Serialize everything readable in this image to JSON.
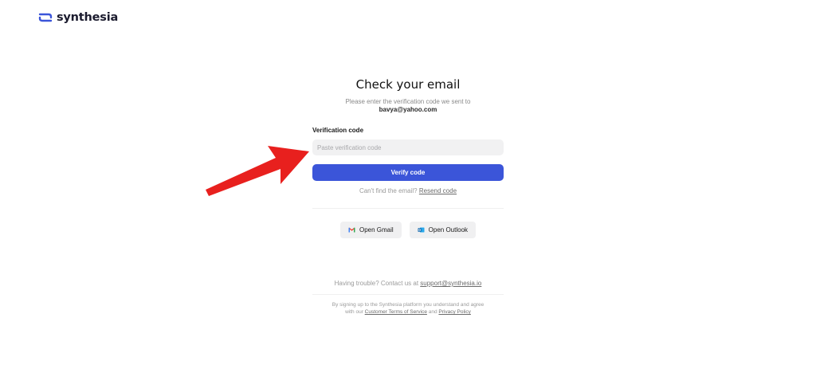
{
  "brand": {
    "name": "synthesia",
    "accent": "#3b55d9"
  },
  "page": {
    "title": "Check your email",
    "subtitle": "Please enter the verification code we sent to",
    "email": "bavya@yahoo.com"
  },
  "form": {
    "code_label": "Verification code",
    "code_placeholder": "Paste verification code",
    "code_value": "",
    "verify_label": "Verify code"
  },
  "resend": {
    "prompt": "Can't find the email?",
    "link": "Resend code"
  },
  "mail_buttons": [
    {
      "label": "Open Gmail",
      "icon": "gmail-icon"
    },
    {
      "label": "Open Outlook",
      "icon": "outlook-icon"
    }
  ],
  "support": {
    "prompt": "Having trouble? Contact us at",
    "email": "support@synthesia.io"
  },
  "legal": {
    "text1": "By signing up to the Synthesia platform you understand and agree",
    "text2": "with our",
    "terms_link": "Customer Terms of Service",
    "and": "and",
    "privacy_link": "Privacy Policy"
  },
  "annotation": {
    "icon": "red-arrow-icon",
    "color": "#e8201e"
  }
}
